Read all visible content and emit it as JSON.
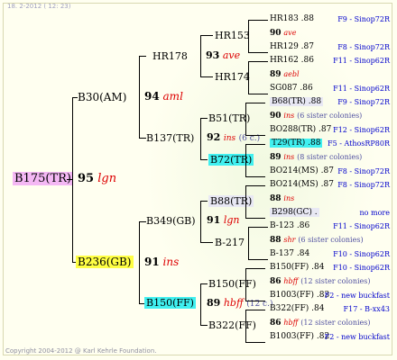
{
  "header": "18.  2-2012 ( 12: 23)",
  "footer": "Copyright 2004-2012 @ Karl Kehrle Foundation.",
  "root": {
    "label": "B175(TR)",
    "num": "95",
    "code": "lgn"
  },
  "p1": {
    "label": "B30(AM)",
    "num": "94",
    "code": "aml"
  },
  "p2": {
    "label": "B236(GB)",
    "num": "91",
    "code": "ins"
  },
  "gp1": {
    "label": "HR178",
    "num": "93",
    "code": "ave"
  },
  "gp2": {
    "label": "B137(TR)",
    "num": "92",
    "code": "ins",
    "note": "(6 c.)"
  },
  "gp3": {
    "label": "B349(GB)",
    "num": "91",
    "code": "lgn"
  },
  "gp4": {
    "label": "B150(FF)",
    "num": "89",
    "code": "hbff",
    "note": "(12 c.)"
  },
  "ggp": [
    {
      "label": "HR153"
    },
    {
      "label": "HR174"
    },
    {
      "label": "B51(TR)"
    },
    {
      "label": "B72(TR)"
    },
    {
      "label": "B88(TR)"
    },
    {
      "label": "B-217"
    },
    {
      "label": "B150(FF)"
    },
    {
      "label": "B322(FF)"
    }
  ],
  "g4": [
    {
      "top": "HR183 .88",
      "top_loc": "F9 - Sinop72R",
      "num": "90",
      "code": "ave",
      "sis": "",
      "bot": "HR129 .87",
      "bot_loc": "F8 - Sinop72R"
    },
    {
      "top": "HR162 .86",
      "top_loc": "F11 - Sinop62R",
      "num": "89",
      "code": "aebl",
      "sis": "",
      "bot": "SG087 .86",
      "bot_loc": "F11 - Sinop62R"
    },
    {
      "top": "B68(TR) .88",
      "top_loc": "F9 - Sinop72R",
      "num": "90",
      "code": "ins",
      "sis": "(6 sister colonies)",
      "bot": "BO288(TR) .87",
      "bot_loc": "F12 - Sinop62R"
    },
    {
      "top": "T29(TR) .88",
      "top_loc": "F5 - AthosRP80R",
      "num": "89",
      "code": "ins",
      "sis": "(8 sister colonies)",
      "bot": "BO214(MS) .87",
      "bot_loc": "F8 - Sinop72R"
    },
    {
      "top": "BO214(MS) .87",
      "top_loc": "F8 - Sinop72R",
      "num": "88",
      "code": "ins",
      "sis": "",
      "bot": "B298(GC) .",
      "bot_loc": "no more"
    },
    {
      "top": "B-123 .86",
      "top_loc": "F11 - Sinop62R",
      "num": "88",
      "code": "shr",
      "sis": "(6 sister colonies)",
      "bot": "B-137 .84",
      "bot_loc": "F10 - Sinop62R"
    },
    {
      "top": "B150(FF) .84",
      "top_loc": "F10 - Sinop62R",
      "num": "86",
      "code": "hbff",
      "sis": "(12 sister colonies)",
      "bot": "B1003(FF) .83",
      "bot_loc": "F2 - new buckfast"
    },
    {
      "top": "B322(FF) .84",
      "top_loc": "F17 - B-xx43",
      "num": "86",
      "code": "hbff",
      "sis": "(12 sister colonies)",
      "bot": "B1003(FF) .82",
      "bot_loc": "F2 - new buckfast"
    }
  ]
}
